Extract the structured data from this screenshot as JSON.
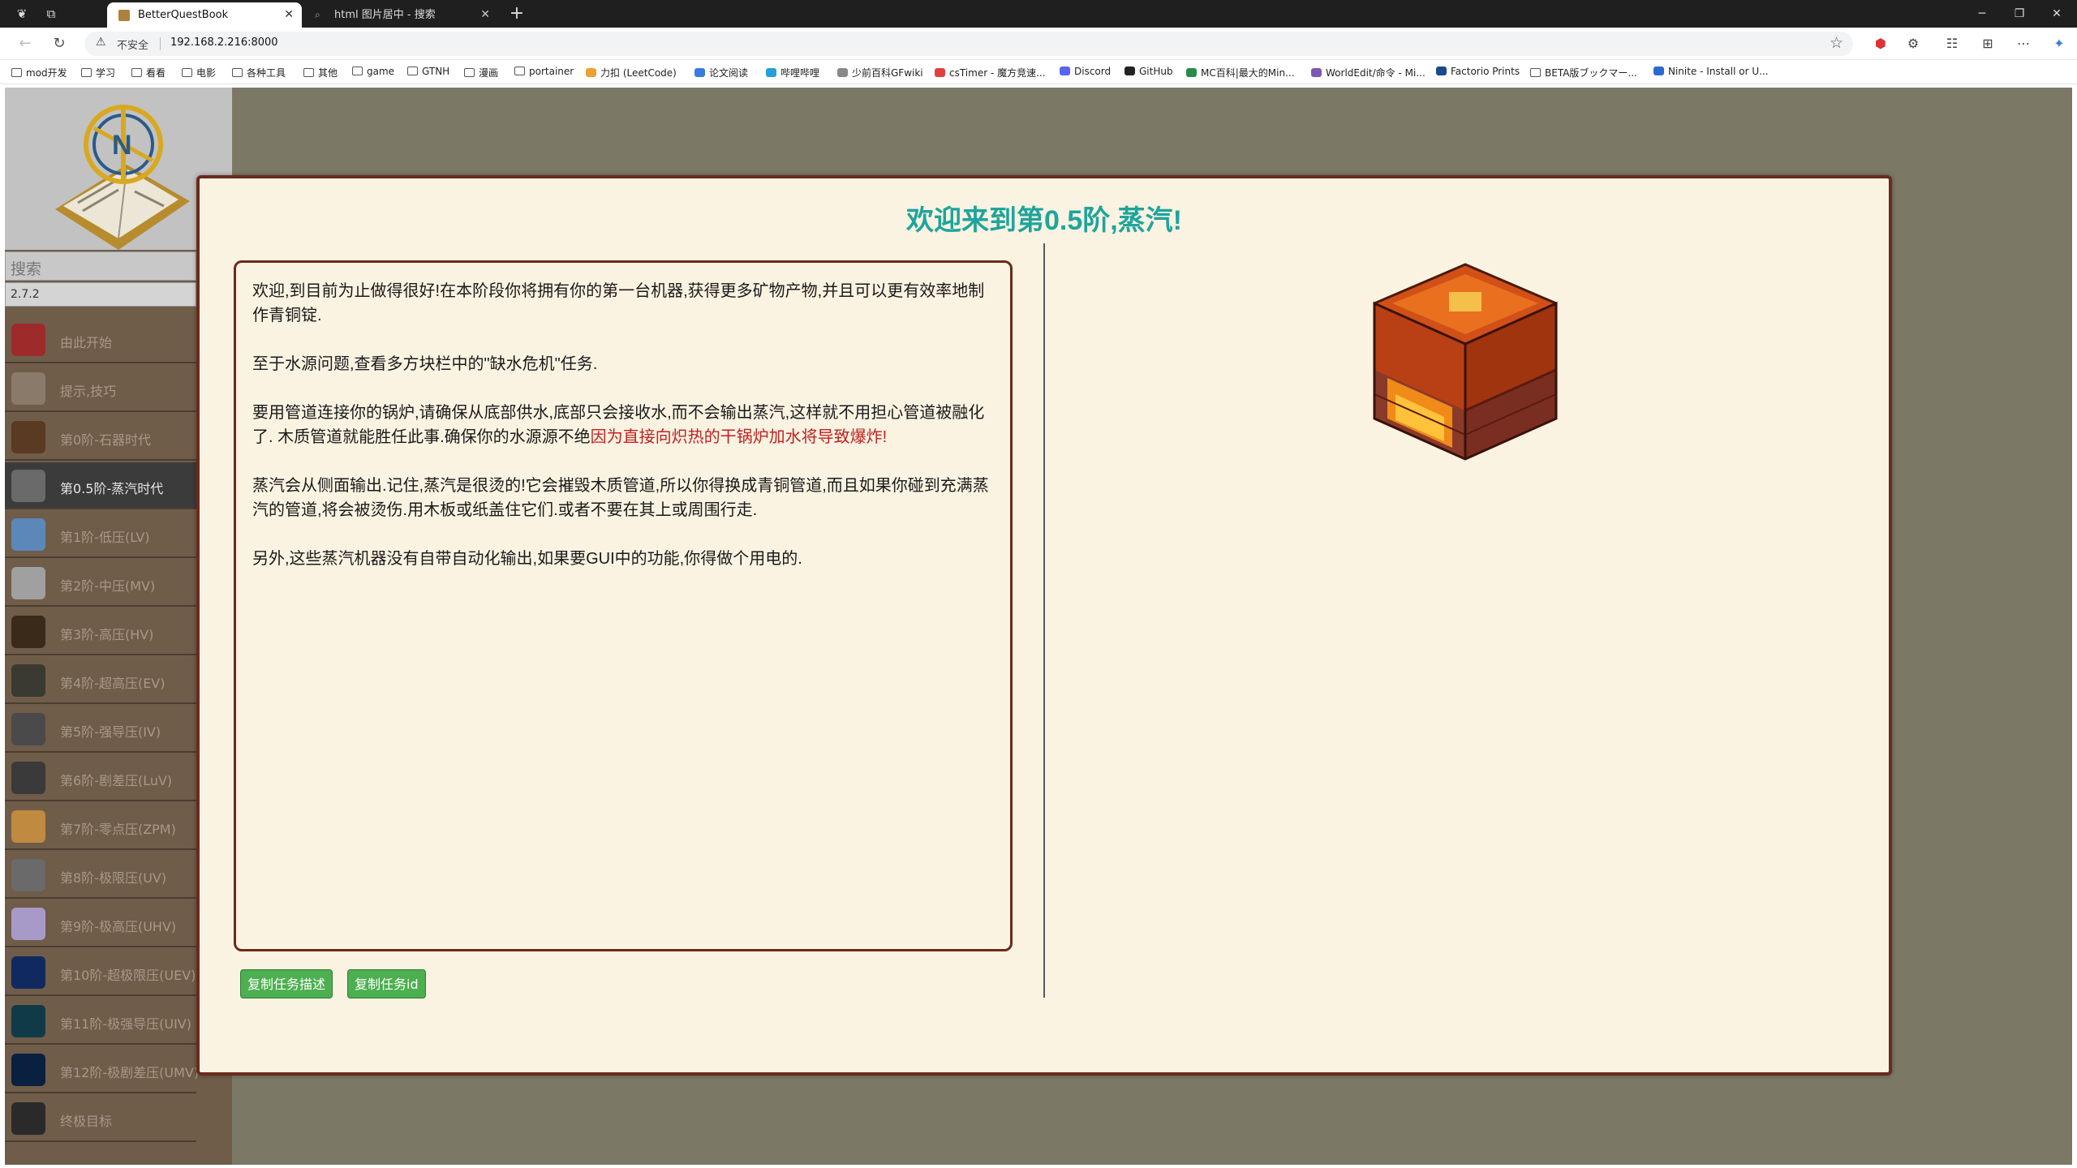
{
  "browser": {
    "tabs": [
      {
        "title": "BetterQuestBook",
        "active": true
      },
      {
        "title": "html 图片居中 - 搜索",
        "active": false
      }
    ],
    "address": {
      "security_label": "不安全",
      "url": "192.168.2.216:8000"
    },
    "bookmarks": [
      {
        "label": "mod开发",
        "icon": "folder-icon"
      },
      {
        "label": "学习",
        "icon": "folder-icon"
      },
      {
        "label": "看看",
        "icon": "folder-icon"
      },
      {
        "label": "电影",
        "icon": "folder-icon"
      },
      {
        "label": "各种工具",
        "icon": "folder-icon"
      },
      {
        "label": "其他",
        "icon": "folder-icon"
      },
      {
        "label": "game",
        "icon": "folder-icon"
      },
      {
        "label": "GTNH",
        "icon": "folder-icon"
      },
      {
        "label": "漫画",
        "icon": "folder-icon"
      },
      {
        "label": "portainer",
        "icon": "folder-icon"
      },
      {
        "label": "力扣 (LeetCode)",
        "icon": "leetcode-icon"
      },
      {
        "label": "论文阅读",
        "icon": "site-icon"
      },
      {
        "label": "哔哩哔哩",
        "icon": "bilibili-icon"
      },
      {
        "label": "少前百科GFwiki",
        "icon": "site-icon"
      },
      {
        "label": "csTimer - 魔方竞速...",
        "icon": "site-icon"
      },
      {
        "label": "Discord",
        "icon": "discord-icon"
      },
      {
        "label": "GitHub",
        "icon": "github-icon"
      },
      {
        "label": "MC百科|最大的Min...",
        "icon": "site-icon"
      },
      {
        "label": "WorldEdit/命令 - Mi...",
        "icon": "site-icon"
      },
      {
        "label": "Factorio Prints",
        "icon": "site-icon"
      },
      {
        "label": "BETA版ブックマー...",
        "icon": "file-icon"
      },
      {
        "label": "Ninite - Install or U...",
        "icon": "site-icon"
      }
    ]
  },
  "sidebar": {
    "search_placeholder": "搜索",
    "version": "2.7.2",
    "items": [
      {
        "label": "由此开始",
        "color": "#9e2a2a",
        "active": false
      },
      {
        "label": "提示,技巧",
        "color": "#8a7a6a",
        "active": false
      },
      {
        "label": "第0阶-石器时代",
        "color": "#5a3a22",
        "active": false
      },
      {
        "label": "第0.5阶-蒸汽时代",
        "color": "#6a6a6a",
        "active": true
      },
      {
        "label": "第1阶-低压(LV)",
        "color": "#5b88b8",
        "active": false
      },
      {
        "label": "第2阶-中压(MV)",
        "color": "#a0a0a0",
        "active": false
      },
      {
        "label": "第3阶-高压(HV)",
        "color": "#3a2a1a",
        "active": false
      },
      {
        "label": "第4阶-超高压(EV)",
        "color": "#3a3a30",
        "active": false
      },
      {
        "label": "第5阶-强导压(IV)",
        "color": "#4a4a4a",
        "active": false
      },
      {
        "label": "第6阶-剧差压(LuV)",
        "color": "#3a3a3a",
        "active": false
      },
      {
        "label": "第7阶-零点压(ZPM)",
        "color": "#c08a40",
        "active": false
      },
      {
        "label": "第8阶-极限压(UV)",
        "color": "#6a6a6a",
        "active": false
      },
      {
        "label": "第9阶-极高压(UHV)",
        "color": "#a89ac8",
        "active": false
      },
      {
        "label": "第10阶-超极限压(UEV)",
        "color": "#102a60",
        "active": false
      },
      {
        "label": "第11阶-极强导压(UIV)",
        "color": "#103a48",
        "active": false
      },
      {
        "label": "第12阶-极剧差压(UMV)",
        "color": "#0a2040",
        "active": false
      },
      {
        "label": "终极目标",
        "color": "#2a2a2a",
        "active": false
      }
    ]
  },
  "quest": {
    "title": "欢迎来到第0.5阶,蒸汽!",
    "paragraphs": [
      "欢迎,到目前为止做得很好!在本阶段你将拥有你的第一台机器,获得更多矿物产物,并且可以更有效率地制作青铜锭.",
      "至于水源问题,查看多方块栏中的\"缺水危机\"任务.",
      "要用管道连接你的锅炉,请确保从底部供水,底部只会接收水,而不会输出蒸汽,这样就不用担心管道被融化了. 木质管道就能胜任此事.确保你的水源源不绝"
    ],
    "warning": "因为直接向炽热的干锅炉加水将导致爆炸!",
    "paragraphs_after": [
      "蒸汽会从侧面输出.记住,蒸汽是很烫的!它会摧毁木质管道,所以你得换成青铜管道,而且如果你碰到充满蒸汽的管道,将会被烫伤.用木板或纸盖住它们.或者不要在其上或周围行走.",
      "另外,这些蒸汽机器没有自带自动化输出,如果要GUI中的功能,你得做个用电的."
    ],
    "buttons": {
      "copy_desc": "复制任务描述",
      "copy_id": "复制任务id"
    },
    "icon": "steam-boiler-icon"
  },
  "colors": {
    "title": "#1ea59c",
    "warning": "#c02020",
    "button": "#4caf50",
    "border": "#6b2a1c"
  }
}
